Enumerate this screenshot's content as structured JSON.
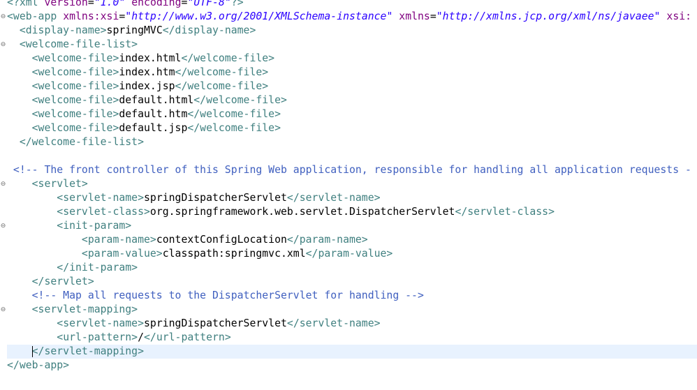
{
  "editor": {
    "lines": [
      {
        "segs": [
          [
            "t",
            "<?"
          ],
          [
            "t",
            "xml "
          ],
          [
            "a",
            "version"
          ],
          [
            "x",
            "="
          ],
          [
            "v",
            "\"1.0\""
          ],
          [
            "x",
            " "
          ],
          [
            "a",
            "encoding"
          ],
          [
            "x",
            "="
          ],
          [
            "v",
            "\"UTF-8\""
          ],
          [
            "t",
            "?>"
          ]
        ]
      },
      {
        "segs": [
          [
            "t",
            "<web-app "
          ],
          [
            "a",
            "xmlns:xsi"
          ],
          [
            "x",
            "="
          ],
          [
            "v",
            "\"http://www.w3.org/2001/XMLSchema-instance\""
          ],
          [
            "x",
            " "
          ],
          [
            "a",
            "xmlns"
          ],
          [
            "x",
            "="
          ],
          [
            "v",
            "\"http://xmlns.jcp.org/xml/ns/javaee\""
          ],
          [
            "x",
            " "
          ],
          [
            "a",
            "xsi:"
          ]
        ],
        "fold": true
      },
      {
        "segs": [
          [
            "x",
            "  "
          ],
          [
            "t",
            "<display-name>"
          ],
          [
            "x",
            "springMVC"
          ],
          [
            "t",
            "</display-name>"
          ]
        ]
      },
      {
        "segs": [
          [
            "x",
            "  "
          ],
          [
            "t",
            "<welcome-file-list>"
          ]
        ],
        "fold": true
      },
      {
        "segs": [
          [
            "x",
            "    "
          ],
          [
            "t",
            "<welcome-file>"
          ],
          [
            "x",
            "index.html"
          ],
          [
            "t",
            "</welcome-file>"
          ]
        ]
      },
      {
        "segs": [
          [
            "x",
            "    "
          ],
          [
            "t",
            "<welcome-file>"
          ],
          [
            "x",
            "index.htm"
          ],
          [
            "t",
            "</welcome-file>"
          ]
        ]
      },
      {
        "segs": [
          [
            "x",
            "    "
          ],
          [
            "t",
            "<welcome-file>"
          ],
          [
            "x",
            "index.jsp"
          ],
          [
            "t",
            "</welcome-file>"
          ]
        ]
      },
      {
        "segs": [
          [
            "x",
            "    "
          ],
          [
            "t",
            "<welcome-file>"
          ],
          [
            "x",
            "default.html"
          ],
          [
            "t",
            "</welcome-file>"
          ]
        ]
      },
      {
        "segs": [
          [
            "x",
            "    "
          ],
          [
            "t",
            "<welcome-file>"
          ],
          [
            "x",
            "default.htm"
          ],
          [
            "t",
            "</welcome-file>"
          ]
        ]
      },
      {
        "segs": [
          [
            "x",
            "    "
          ],
          [
            "t",
            "<welcome-file>"
          ],
          [
            "x",
            "default.jsp"
          ],
          [
            "t",
            "</welcome-file>"
          ]
        ]
      },
      {
        "segs": [
          [
            "x",
            "  "
          ],
          [
            "t",
            "</welcome-file-list>"
          ]
        ]
      },
      {
        "segs": []
      },
      {
        "segs": [
          [
            "x",
            " "
          ],
          [
            "c",
            "<!-- The front controller of this Spring Web application, responsible for handling all application requests -"
          ]
        ]
      },
      {
        "segs": [
          [
            "x",
            "    "
          ],
          [
            "t",
            "<servlet>"
          ]
        ],
        "fold": true
      },
      {
        "segs": [
          [
            "x",
            "        "
          ],
          [
            "t",
            "<servlet-name>"
          ],
          [
            "x",
            "springDispatcherServlet"
          ],
          [
            "t",
            "</servlet-name>"
          ]
        ]
      },
      {
        "segs": [
          [
            "x",
            "        "
          ],
          [
            "t",
            "<servlet-class>"
          ],
          [
            "x",
            "org.springframework.web.servlet.DispatcherServlet"
          ],
          [
            "t",
            "</servlet-class>"
          ]
        ]
      },
      {
        "segs": [
          [
            "x",
            "        "
          ],
          [
            "t",
            "<init-param>"
          ]
        ],
        "fold": true
      },
      {
        "segs": [
          [
            "x",
            "            "
          ],
          [
            "t",
            "<param-name>"
          ],
          [
            "x",
            "contextConfigLocation"
          ],
          [
            "t",
            "</param-name>"
          ]
        ]
      },
      {
        "segs": [
          [
            "x",
            "            "
          ],
          [
            "t",
            "<param-value>"
          ],
          [
            "x",
            "classpath:springmvc.xml"
          ],
          [
            "t",
            "</param-value>"
          ]
        ]
      },
      {
        "segs": [
          [
            "x",
            "        "
          ],
          [
            "t",
            "</init-param>"
          ]
        ]
      },
      {
        "segs": [
          [
            "x",
            "    "
          ],
          [
            "t",
            "</servlet>"
          ]
        ]
      },
      {
        "segs": [
          [
            "x",
            "    "
          ],
          [
            "c",
            "<!-- Map all requests to the DispatcherServlet for handling -->"
          ]
        ]
      },
      {
        "segs": [
          [
            "x",
            "    "
          ],
          [
            "t",
            "<servlet-mapping>"
          ]
        ],
        "fold": true
      },
      {
        "segs": [
          [
            "x",
            "        "
          ],
          [
            "t",
            "<servlet-name>"
          ],
          [
            "x",
            "springDispatcherServlet"
          ],
          [
            "t",
            "</servlet-name>"
          ]
        ]
      },
      {
        "segs": [
          [
            "x",
            "        "
          ],
          [
            "t",
            "<url-pattern>"
          ],
          [
            "x",
            "/"
          ],
          [
            "t",
            "</url-pattern>"
          ]
        ]
      },
      {
        "segs": [
          [
            "x",
            "    "
          ],
          [
            "t",
            "</servlet-mapping>"
          ]
        ],
        "current": true
      },
      {
        "segs": [
          [
            "t",
            "</web-app>"
          ]
        ]
      }
    ],
    "fold_icon": "collapse-minus-icon",
    "colors": {
      "tag": "#3f7f7f",
      "attribute": "#7f007f",
      "attribute_value": "#2a00ff",
      "content": "#000000",
      "comment": "#3f5fbf",
      "current_line": "#e8f2fe"
    }
  }
}
